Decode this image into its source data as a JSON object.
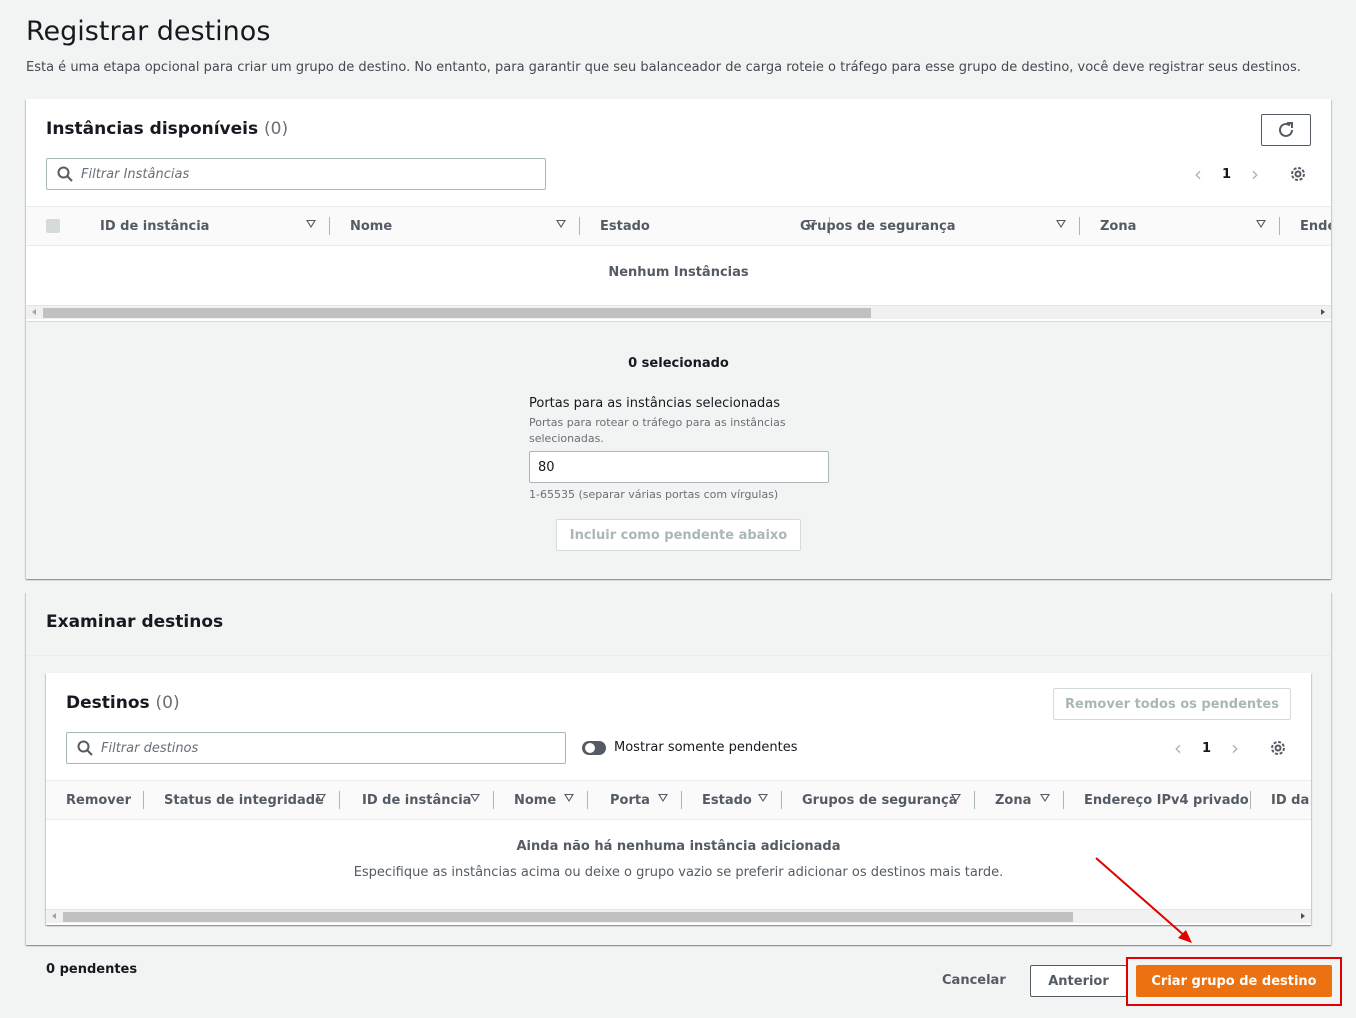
{
  "page": {
    "title": "Registrar destinos",
    "description": "Esta é uma etapa opcional para criar um grupo de destino. No entanto, para garantir que seu balanceador de carga roteie o tráfego para esse grupo de destino, você deve registrar seus destinos."
  },
  "available": {
    "title": "Instâncias disponíveis",
    "count": "(0)",
    "search_placeholder": "Filtrar Instâncias",
    "page": "1",
    "columns": [
      "ID de instância",
      "Nome",
      "Estado",
      "Grupos de segurança",
      "Zona",
      "Ende"
    ],
    "empty": "Nenhum Instâncias"
  },
  "selection": {
    "selected": "0 selecionado",
    "ports_label": "Portas para as instâncias selecionadas",
    "ports_description": "Portas para rotear o tráfego para as instâncias selecionadas.",
    "ports_value": "80",
    "ports_hint": "1-65535 (separar várias portas com vírgulas)",
    "include_button": "Incluir como pendente abaixo"
  },
  "review": {
    "title": "Examinar destinos",
    "targets_title": "Destinos",
    "targets_count": "(0)",
    "remove_all_button": "Remover todos os pendentes",
    "search_placeholder": "Filtrar destinos",
    "toggle_label": "Mostrar somente pendentes",
    "page": "1",
    "columns": [
      "Remover",
      "Status de integridade",
      "ID de instância",
      "Nome",
      "Porta",
      "Estado",
      "Grupos de segurança",
      "Zona",
      "Endereço IPv4 privado",
      "ID da s"
    ],
    "empty_title": "Ainda não há nenhuma instância adicionada",
    "empty_desc": "Especifique as instâncias acima ou deixe o grupo vazio se preferir adicionar os destinos mais tarde."
  },
  "footer": {
    "pending": "0 pendentes",
    "cancel": "Cancelar",
    "previous": "Anterior",
    "create": "Criar grupo de destino"
  },
  "colors": {
    "primary": "#ec7211",
    "highlight": "#e00000"
  }
}
